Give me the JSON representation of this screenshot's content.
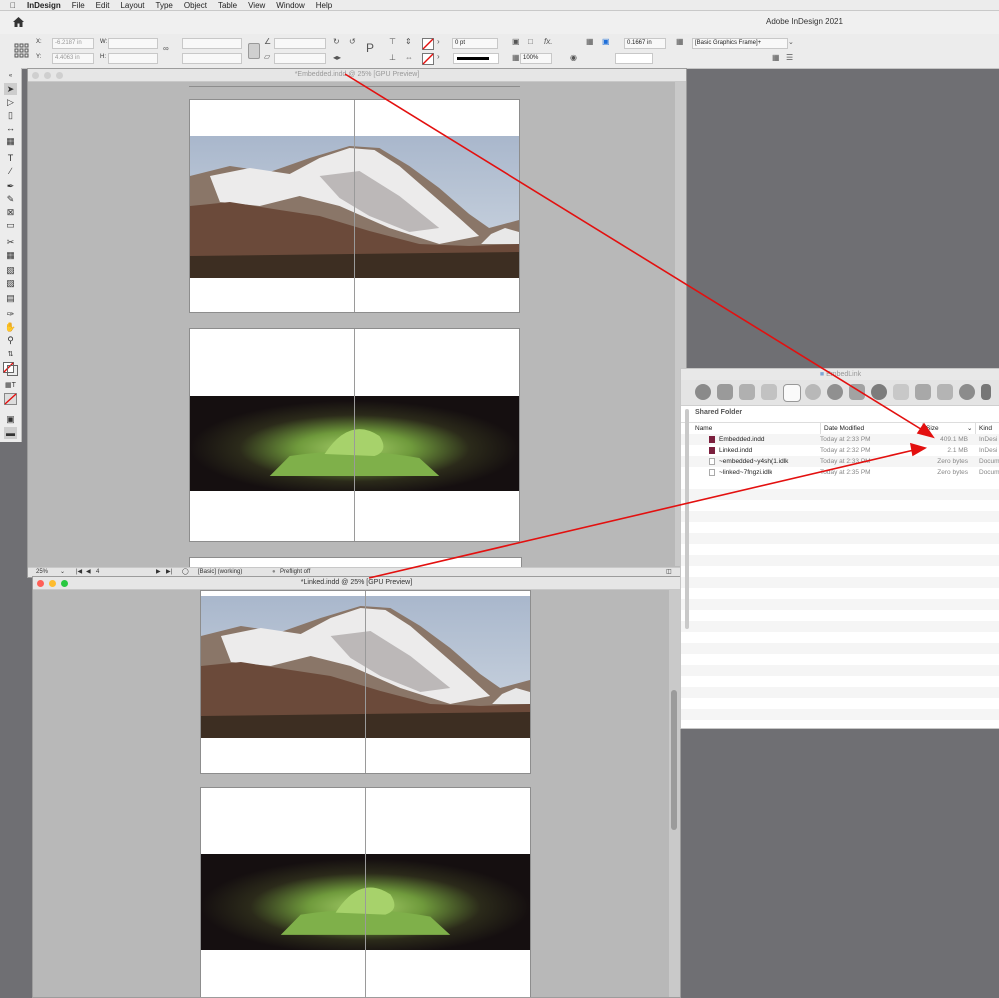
{
  "menubar": {
    "app_name": "InDesign",
    "items": [
      "File",
      "Edit",
      "Layout",
      "Type",
      "Object",
      "Table",
      "View",
      "Window",
      "Help"
    ]
  },
  "appbar": {
    "title": "Adobe InDesign 2021"
  },
  "control": {
    "x_label": "X:",
    "x_value": "-6.2187 in",
    "y_label": "Y:",
    "y_value": "4.4063 in",
    "w_label": "W:",
    "h_label": "H:",
    "stroke_weight": "0 pt",
    "opacity": "100%",
    "offset": "0.1667 in",
    "object_style": "[Basic Graphics Frame]+"
  },
  "embedded_window": {
    "title": "*Embedded.indd @ 25% [GPU Preview]",
    "zoom": "25%",
    "page_number": "4",
    "style": "[Basic] (working)",
    "preflight": "Preflight off"
  },
  "linked_window": {
    "title": "*Linked.indd @ 25% [GPU Preview]"
  },
  "finder": {
    "title": "EmbedLink",
    "section": "Shared Folder",
    "columns": {
      "name": "Name",
      "date": "Date Modified",
      "size": "Size",
      "kind": "Kind"
    },
    "files": [
      {
        "name": "Embedded.indd",
        "date": "Today at 2:33 PM",
        "size": "409.1 MB",
        "kind": "InDesi"
      },
      {
        "name": "Linked.indd",
        "date": "Today at 2:32 PM",
        "size": "2.1 MB",
        "kind": "InDesi"
      },
      {
        "name": "~embedded~y4sh(1.idlk",
        "date": "Today at 2:33 PM",
        "size": "Zero bytes",
        "kind": "Docum"
      },
      {
        "name": "~linked~7fngzi.idlk",
        "date": "Today at 2:35 PM",
        "size": "Zero bytes",
        "kind": "Docum"
      }
    ]
  },
  "colors": {
    "arrow": "#e3100f",
    "pasteboard": "#b8b8b8",
    "desktop": "#6f6f73"
  }
}
